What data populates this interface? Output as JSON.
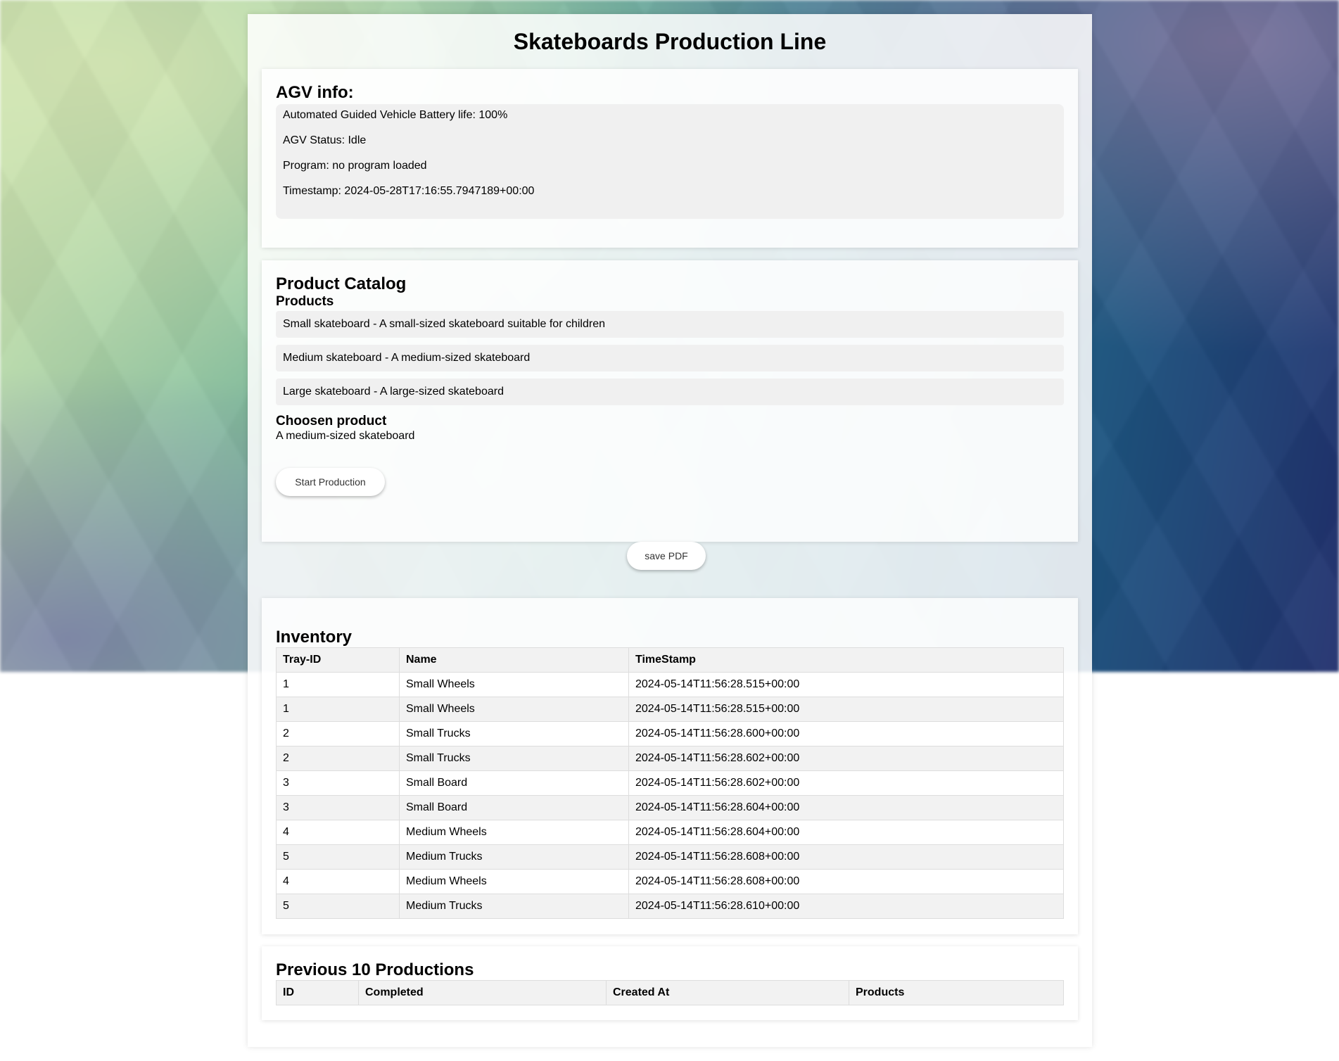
{
  "page": {
    "title": "Skateboards Production Line"
  },
  "agv": {
    "heading": "AGV info:",
    "battery": "Automated Guided Vehicle Battery life: 100%",
    "status": "AGV Status: Idle",
    "program": "Program: no program loaded",
    "timestamp": "Timestamp: 2024-05-28T17:16:55.7947189+00:00"
  },
  "catalog": {
    "heading": "Product Catalog",
    "products_heading": "Products",
    "products": [
      "Small skateboard - A small-sized skateboard suitable for children",
      "Medium skateboard - A medium-sized skateboard",
      "Large skateboard - A large-sized skateboard"
    ],
    "chosen_heading": "Choosen product",
    "chosen_value": "A medium-sized skateboard",
    "start_button": "Start Production"
  },
  "actions": {
    "save_pdf": "save PDF"
  },
  "inventory": {
    "heading": "Inventory",
    "columns": [
      "Tray-ID",
      "Name",
      "TimeStamp"
    ],
    "rows": [
      [
        "1",
        "Small Wheels",
        "2024-05-14T11:56:28.515+00:00"
      ],
      [
        "1",
        "Small Wheels",
        "2024-05-14T11:56:28.515+00:00"
      ],
      [
        "2",
        "Small Trucks",
        "2024-05-14T11:56:28.600+00:00"
      ],
      [
        "2",
        "Small Trucks",
        "2024-05-14T11:56:28.602+00:00"
      ],
      [
        "3",
        "Small Board",
        "2024-05-14T11:56:28.602+00:00"
      ],
      [
        "3",
        "Small Board",
        "2024-05-14T11:56:28.604+00:00"
      ],
      [
        "4",
        "Medium Wheels",
        "2024-05-14T11:56:28.604+00:00"
      ],
      [
        "5",
        "Medium Trucks",
        "2024-05-14T11:56:28.608+00:00"
      ],
      [
        "4",
        "Medium Wheels",
        "2024-05-14T11:56:28.608+00:00"
      ],
      [
        "5",
        "Medium Trucks",
        "2024-05-14T11:56:28.610+00:00"
      ]
    ]
  },
  "previous": {
    "heading": "Previous 10 Productions",
    "columns": [
      "ID",
      "Completed",
      "Created At",
      "Products"
    ]
  }
}
